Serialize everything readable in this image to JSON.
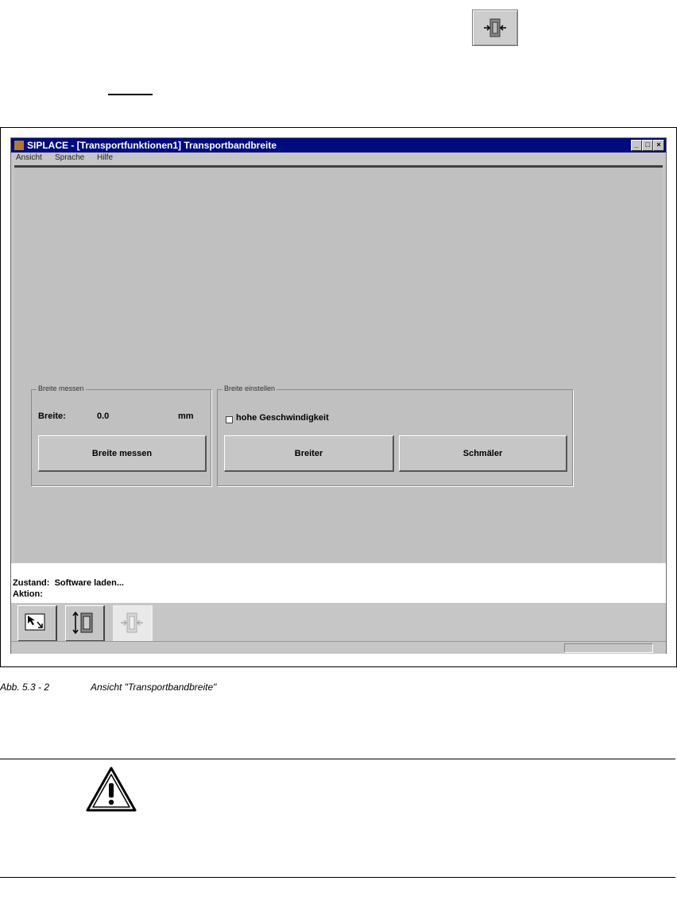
{
  "window": {
    "title": "SIPLACE - [Transportfunktionen1] Transportbandbreite",
    "controls": [
      "minimize-icon",
      "maximize-icon",
      "close-icon"
    ]
  },
  "menu": {
    "items": [
      "Ansicht",
      "Sprache",
      "Hilfe"
    ]
  },
  "measure_group": {
    "label": "Breite messen",
    "field_label": "Breite:",
    "value": "0.0",
    "unit": "mm",
    "button": "Breite messen"
  },
  "adjust_group": {
    "label": "Breite einstellen",
    "checkbox_label": "hohe Geschwindigkeit",
    "checkbox_checked": false,
    "wider_button": "Breiter",
    "narrower_button": "Schmäler"
  },
  "status": {
    "state_label": "Zustand:",
    "state_value": "Software laden...",
    "action_label": "Aktion:"
  },
  "toolbar": {
    "buttons": [
      {
        "icon": "pointer-icon",
        "disabled": false
      },
      {
        "icon": "conveyor-height-icon",
        "disabled": false
      },
      {
        "icon": "conveyor-width-icon",
        "disabled": true
      }
    ]
  },
  "caption": {
    "number": "Abb. 5.3 - 2",
    "text": "Ansicht \"Transportbandbreite\""
  },
  "icons": {
    "top": "conveyor-width-icon",
    "warning": "warning-triangle-icon"
  },
  "colors": {
    "titlebar": "#000a80",
    "window_bg": "#c0c0c0"
  }
}
